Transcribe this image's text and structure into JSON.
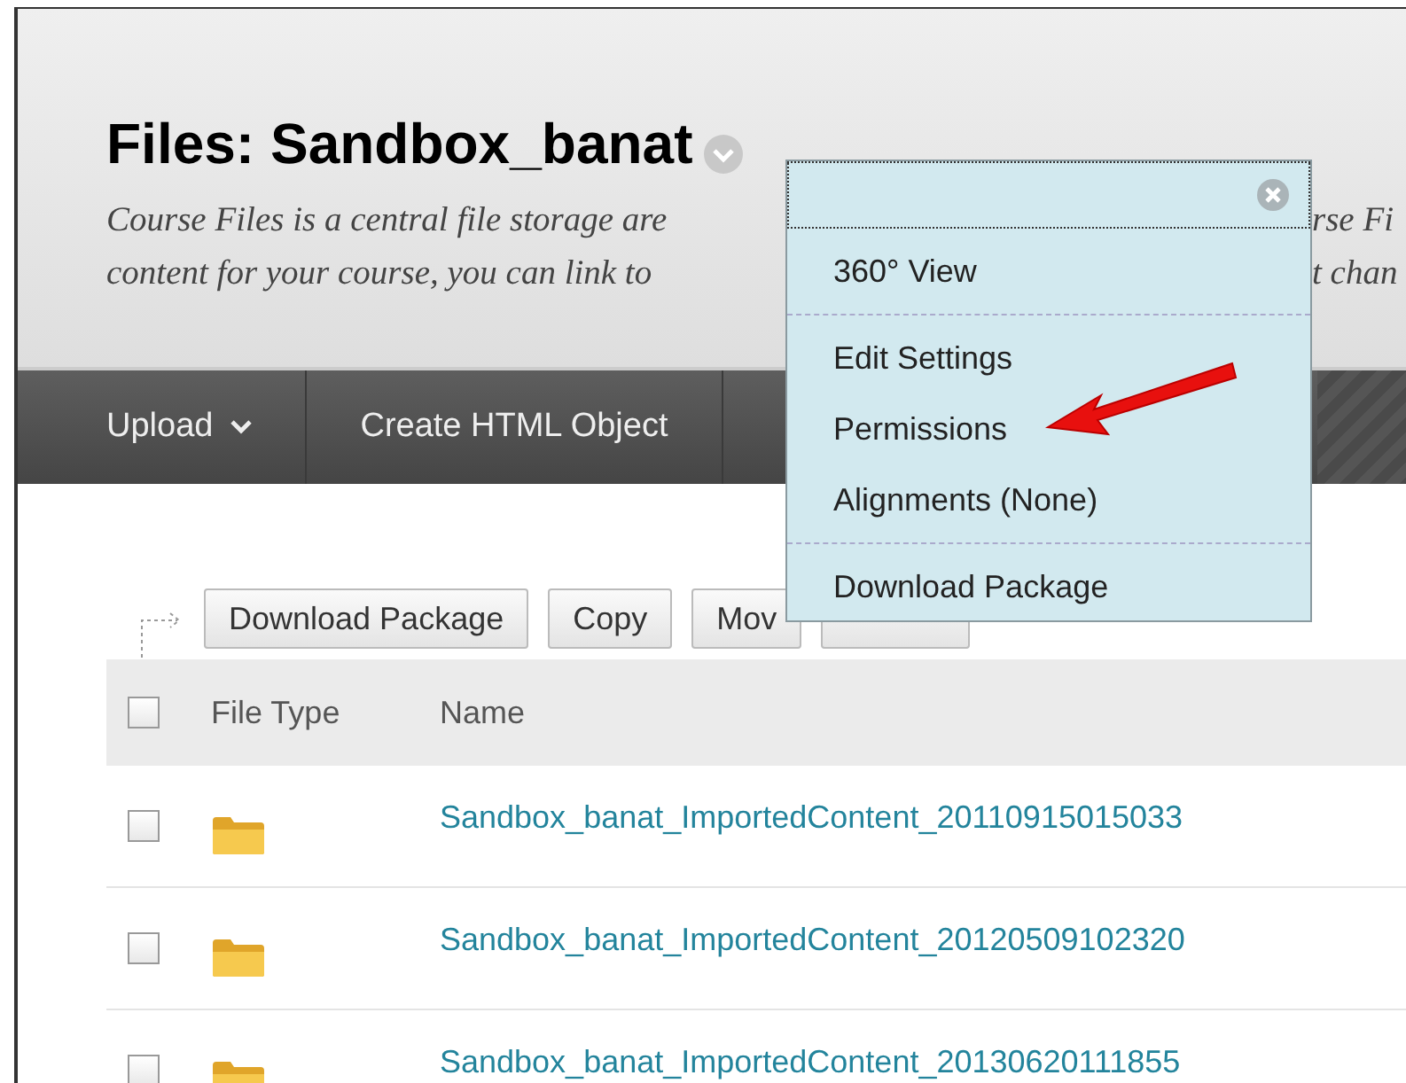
{
  "page": {
    "title": "Files: Sandbox_banat",
    "description_lines": [
      {
        "left": "Course Files is a central file storage are",
        "right": "rse Fi"
      },
      {
        "left": "content for your course, you can link to",
        "right": "t chan"
      }
    ]
  },
  "toolbar": [
    {
      "label": "Upload",
      "kind": "dropdown"
    },
    {
      "label": "Create HTML Object",
      "kind": "button"
    }
  ],
  "actions": [
    {
      "label": "Download Package",
      "kind": "button"
    },
    {
      "label": "Copy",
      "kind": "button"
    },
    {
      "label": "Mov",
      "kind": "button"
    },
    {
      "kind": "covered"
    }
  ],
  "table": {
    "header_checked": false,
    "columns": [
      "File Type",
      "Name"
    ],
    "rows": [
      {
        "checked": false,
        "kind": "folder",
        "name": "Sandbox_banat_ImportedContent_20110915015033"
      },
      {
        "checked": false,
        "kind": "folder",
        "name": "Sandbox_banat_ImportedContent_20120509102320"
      },
      {
        "checked": false,
        "kind": "folder",
        "name": "Sandbox_banat_ImportedContent_20130620111855"
      }
    ]
  },
  "menu": {
    "groups": [
      [
        "360° View"
      ],
      [
        "Edit Settings",
        "Permissions",
        "Alignments (None)"
      ],
      [
        "Download Package"
      ]
    ]
  }
}
